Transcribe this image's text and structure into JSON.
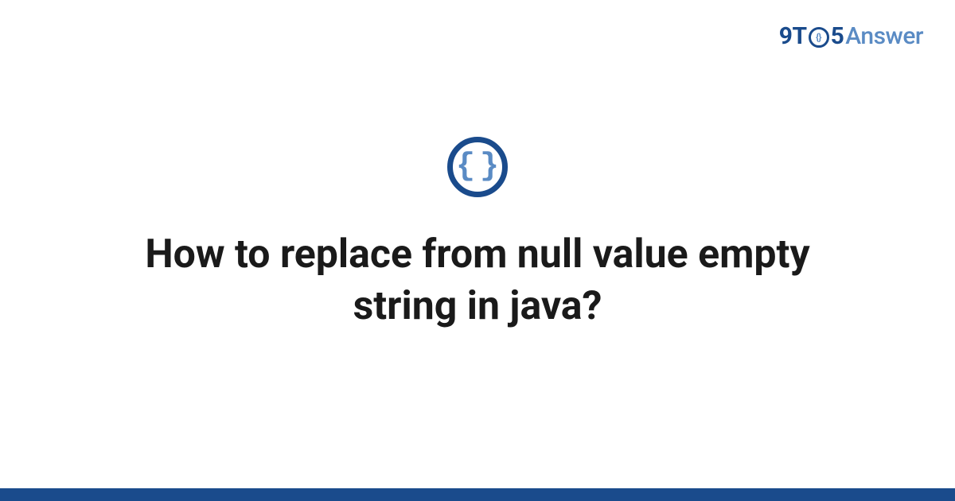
{
  "brand": {
    "nine": "9",
    "t": "T",
    "o_inner": "{}",
    "five": "5",
    "answer": "Answer"
  },
  "category": {
    "braces": "{}"
  },
  "title": "How to replace from null value empty string in java?",
  "colors": {
    "primary": "#1a4b8c",
    "secondary": "#5a8bc4",
    "text": "#1a1a1a",
    "background": "#ffffff"
  }
}
